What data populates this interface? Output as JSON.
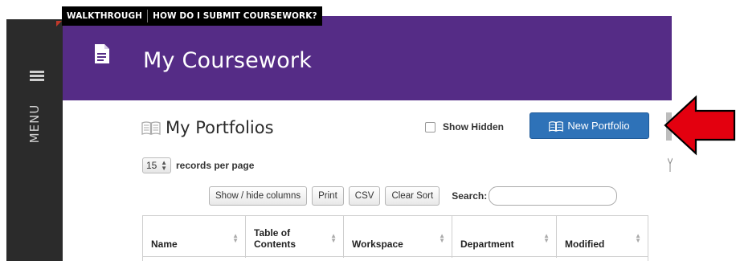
{
  "top_tabs": [
    "WALKTHROUGH",
    "HOW DO I SUBMIT COURSEWORK?"
  ],
  "sidebar": {
    "menu_label": "MENU"
  },
  "header": {
    "title": "My Coursework"
  },
  "portfolios": {
    "title": "My Portfolios",
    "show_hidden_label": "Show Hidden",
    "new_portfolio_label": "New Portfolio"
  },
  "records": {
    "value": "15",
    "label": "records per page"
  },
  "toolbar": {
    "show_hide_label": "Show / hide columns",
    "print_label": "Print",
    "csv_label": "CSV",
    "clear_sort_label": "Clear Sort",
    "search_label": "Search:",
    "search_value": ""
  },
  "table": {
    "columns": [
      "Name",
      "Table of Contents",
      "Workspace",
      "Department",
      "Modified"
    ]
  },
  "colors": {
    "header_purple": "#552c86",
    "button_blue": "#2e72b8",
    "arrow_red": "#e3000f",
    "sidebar_dark": "#2b2b2b"
  },
  "icons": [
    "hamburger-icon",
    "document-icon",
    "book-icon",
    "sort-icon",
    "red-arrow-annotation"
  ]
}
